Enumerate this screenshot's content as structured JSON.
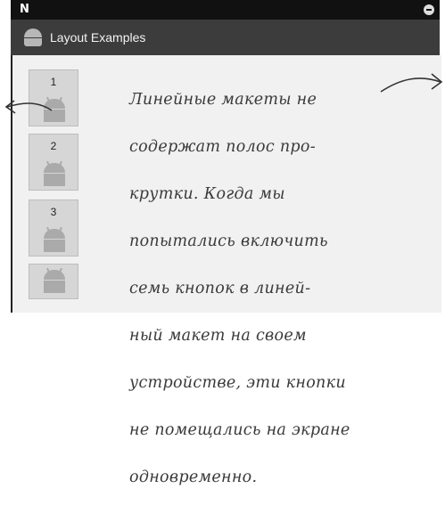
{
  "statusbar": {
    "left_icon": "N",
    "right_icon": "minus-circle-icon"
  },
  "actionbar": {
    "title": "Layout Examples",
    "icon": "android-icon"
  },
  "buttons": [
    {
      "label": "1"
    },
    {
      "label": "2"
    },
    {
      "label": "3"
    },
    {
      "label": ""
    }
  ],
  "annotation": {
    "lines": [
      "Линейные макеты не",
      "содержат полос про-",
      "крутки. Когда мы",
      "попытались включить",
      "семь кнопок в линей-",
      "ный макет на своем",
      "устройстве, эти кнопки",
      "не помещались на экране",
      "одновременно."
    ]
  },
  "colors": {
    "statusbar": "#111111",
    "actionbar": "#3c3c3c",
    "content": "#f1f1f1",
    "button": "#d6d6d6"
  }
}
